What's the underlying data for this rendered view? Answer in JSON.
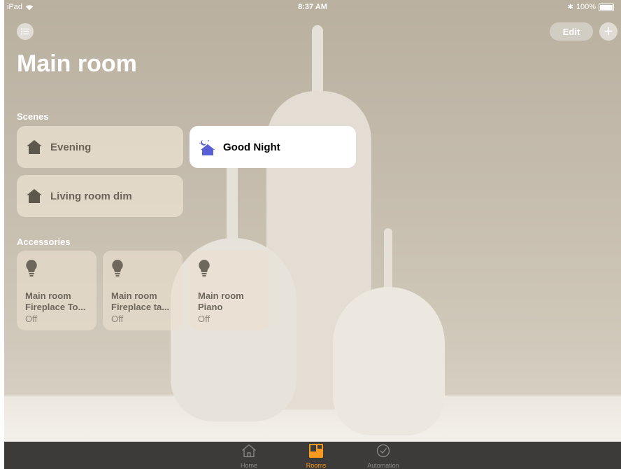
{
  "status_bar": {
    "device": "iPad",
    "time": "8:37 AM",
    "battery": "100%"
  },
  "header": {
    "edit_label": "Edit",
    "add_label": "+"
  },
  "room_title": "Main room",
  "scenes": {
    "heading": "Scenes",
    "items": [
      {
        "label": "Evening",
        "icon": "house-icon",
        "active": false
      },
      {
        "label": "Good Night",
        "icon": "good-night-icon",
        "active": true
      },
      {
        "label": "Living room dim",
        "icon": "house-icon",
        "active": false
      }
    ]
  },
  "accessories": {
    "heading": "Accessories",
    "items": [
      {
        "line1": "Main room",
        "line2": "Fireplace To...",
        "state": "Off",
        "icon": "lightbulb-icon"
      },
      {
        "line1": "Main room",
        "line2": "Fireplace ta...",
        "state": "Off",
        "icon": "lightbulb-icon"
      },
      {
        "line1": "Main room",
        "line2": "Piano",
        "state": "Off",
        "icon": "lightbulb-icon"
      }
    ]
  },
  "tab_bar": {
    "tabs": [
      {
        "label": "Home",
        "icon": "home-tab-icon",
        "active": false
      },
      {
        "label": "Rooms",
        "icon": "rooms-tab-icon",
        "active": true
      },
      {
        "label": "Automation",
        "icon": "automation-tab-icon",
        "active": false
      }
    ]
  },
  "colors": {
    "accent": "#f79a1e",
    "good_night_icon": "#5b5fd6"
  }
}
